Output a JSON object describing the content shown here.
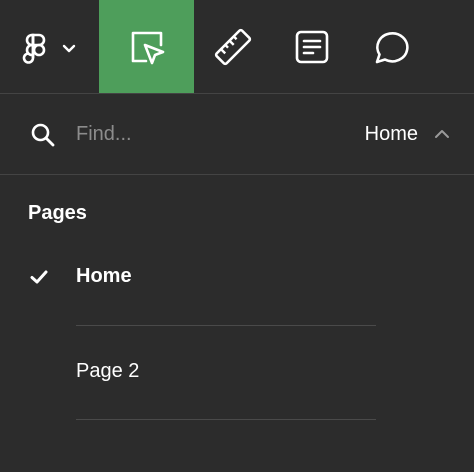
{
  "toolbar": {
    "tools": [
      {
        "icon": "figma-logo-icon",
        "has_dropdown": true
      },
      {
        "icon": "cursor-select-icon",
        "active": true
      },
      {
        "icon": "ruler-icon"
      },
      {
        "icon": "document-notes-icon"
      },
      {
        "icon": "comment-bubble-icon"
      }
    ],
    "active_color": "#4e9e5b"
  },
  "find": {
    "placeholder": "Find...",
    "value": "",
    "current_page": "Home"
  },
  "pages": {
    "header": "Pages",
    "items": [
      {
        "label": "Home",
        "selected": true
      },
      {
        "label": "Page 2",
        "selected": false
      }
    ]
  }
}
